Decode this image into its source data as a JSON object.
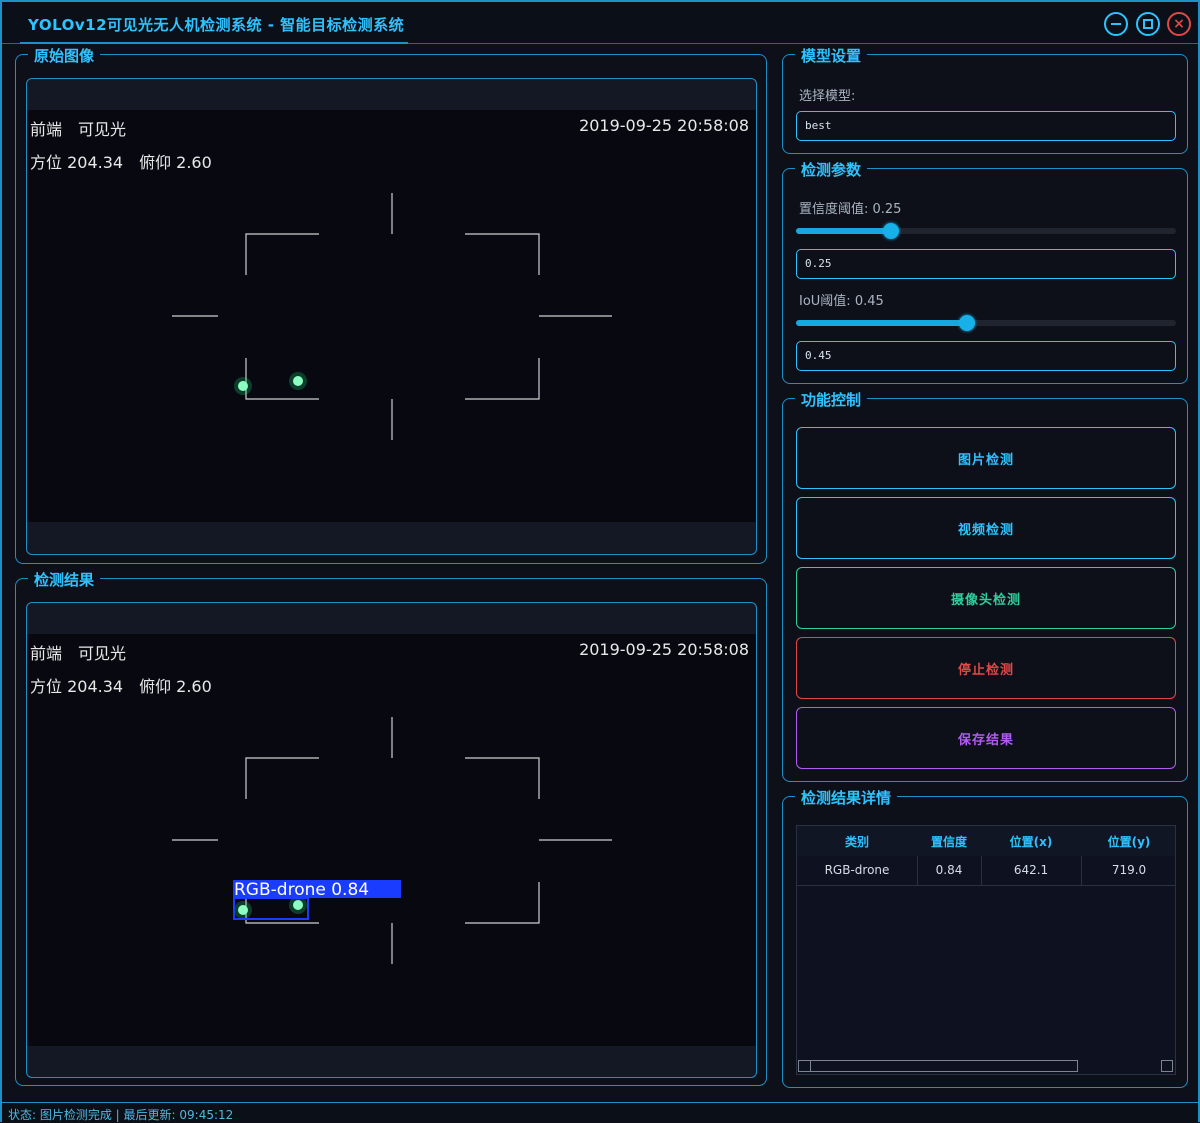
{
  "window": {
    "title": "YOLOv12可见光无人机检测系统 - 智能目标检测系统",
    "controls": {
      "minimize": "minimize-icon",
      "maximize": "maximize-icon",
      "close": "close-icon"
    }
  },
  "original_panel": {
    "title": "原始图像",
    "overlay": {
      "line1_a": "前端",
      "line1_b": "可见光",
      "timestamp": "2019-09-25 20:58:08",
      "azimuth": "方位 204.34",
      "pitch": "俯仰 2.60"
    }
  },
  "result_panel": {
    "title": "检测结果",
    "overlay": {
      "line1_a": "前端",
      "line1_b": "可见光",
      "timestamp": "2019-09-25 20:58:08",
      "azimuth": "方位 204.34",
      "pitch": "俯仰 2.60"
    },
    "detection_label": "RGB-drone 0.84"
  },
  "model_settings": {
    "title": "模型设置",
    "select_label": "选择模型:",
    "model_value": "best"
  },
  "detection_params": {
    "title": "检测参数",
    "conf_label": "置信度阈值: 0.25",
    "conf_value": "0.25",
    "conf_fraction": 0.25,
    "iou_label": "IoU阈值: 0.45",
    "iou_value": "0.45",
    "iou_fraction": 0.45
  },
  "function_control": {
    "title": "功能控制",
    "buttons": [
      {
        "label": "图片检测",
        "color": "#2ec3ff"
      },
      {
        "label": "视频检测",
        "color": "#2ec3ff"
      },
      {
        "label": "摄像头检测",
        "color": "#2ecf9a"
      },
      {
        "label": "停止检测",
        "color": "#e04848"
      },
      {
        "label": "保存结果",
        "color": "#b05cf0"
      }
    ]
  },
  "results_detail": {
    "title": "检测结果详情",
    "columns": [
      "类别",
      "置信度",
      "位置(x)",
      "位置(y)"
    ],
    "rows": [
      [
        "RGB-drone",
        "0.84",
        "642.1",
        "719.0"
      ]
    ]
  },
  "status": {
    "text": "状态: 图片检测完成 | 最后更新: 09:45:12"
  },
  "colors": {
    "accent": "#2ec3ff",
    "border": "#1e90c8",
    "danger": "#e04848",
    "success": "#2ecf9a",
    "purple": "#b05cf0"
  }
}
